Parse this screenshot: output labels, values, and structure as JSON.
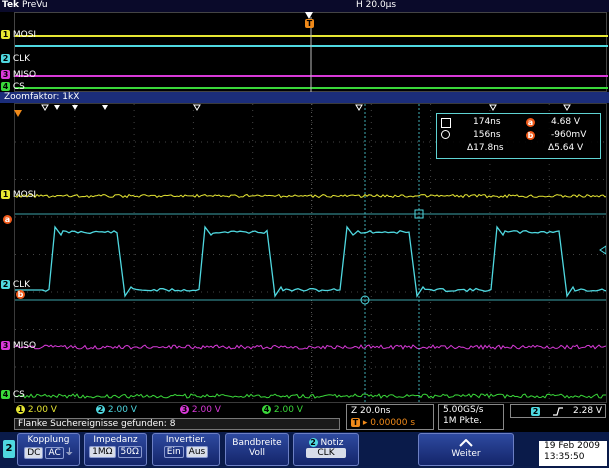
{
  "topbar": {
    "brand": "Tek",
    "mode": "PreVu",
    "horizontal_scale": "H 20.0µs"
  },
  "zoom_header": "Zoomfaktor: 1kX",
  "trigger_marker": "T",
  "preview_channels": [
    {
      "num": "1",
      "label": "MOSI",
      "color": "#e6e633"
    },
    {
      "num": "2",
      "label": "CLK",
      "color": "#4fd8e0"
    },
    {
      "num": "3",
      "label": "MISO",
      "color": "#d83ad8"
    },
    {
      "num": "4",
      "label": "CS",
      "color": "#3ad83a"
    }
  ],
  "main_channels": [
    {
      "num": "1",
      "label": "MOSI",
      "color": "#e6e633"
    },
    {
      "num": "2",
      "label": "CLK",
      "color": "#4fd8e0"
    },
    {
      "num": "3",
      "label": "MISO",
      "color": "#d83ad8"
    },
    {
      "num": "4",
      "label": "CS",
      "color": "#3ad83a"
    }
  ],
  "cursor_readout": {
    "rows": [
      {
        "left": "174ns",
        "marker": "a",
        "right": "4.68 V"
      },
      {
        "left": "156ns",
        "marker": "b",
        "right": "-960mV"
      },
      {
        "left": "Δ17.8ns",
        "marker": "",
        "right": "Δ5.64 V"
      }
    ]
  },
  "cursor_markers": {
    "a": "a",
    "b": "b"
  },
  "channel_scales": [
    {
      "num": "1",
      "value": "2.00 V",
      "color": "#e6e633"
    },
    {
      "num": "2",
      "value": "2.00 V",
      "color": "#4fd8e0"
    },
    {
      "num": "3",
      "value": "2.00 V",
      "color": "#d83ad8"
    },
    {
      "num": "4",
      "value": "2.00 V",
      "color": "#3ad83a"
    }
  ],
  "message": "Flanke Suchereignisse gefunden: 8",
  "zoom_info": {
    "timebase": "Z 20.0ns",
    "position": "0.00000 s"
  },
  "sample_rate": {
    "rate": "5.00GS/s",
    "points": "1M Pkte."
  },
  "trigger": {
    "channel": "2",
    "level": "2.28 V"
  },
  "menu": {
    "channel_badge": "2",
    "kopplung": {
      "title": "Kopplung",
      "opt1": "DC",
      "opt2": "AC"
    },
    "impedanz": {
      "title": "Impedanz",
      "opt1": "1MΩ",
      "opt2": "50Ω"
    },
    "invertier": {
      "title": "Invertier.",
      "opt1": "Ein",
      "opt2": "Aus"
    },
    "bandbreite": {
      "title": "Bandbreite",
      "value": "Voll"
    },
    "notiz": {
      "badge": "2",
      "title": "Notiz",
      "value": "CLK"
    },
    "weiter": "Weiter"
  },
  "datetime": {
    "date": "19 Feb  2009",
    "time": "13:35:50"
  }
}
